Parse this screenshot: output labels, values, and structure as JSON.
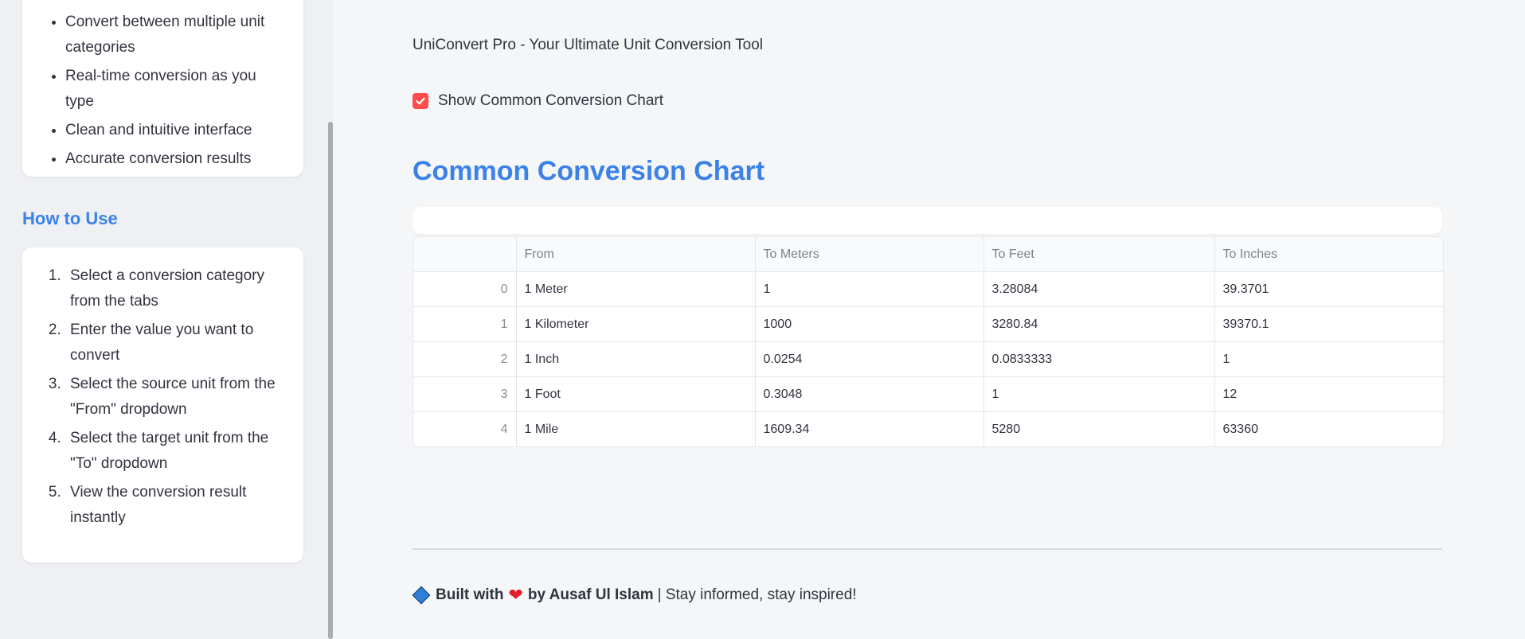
{
  "sidebar": {
    "features": [
      "Convert between multiple unit categories",
      "Real-time conversion as you type",
      "Clean and intuitive interface",
      "Accurate conversion results"
    ],
    "howto_heading": "How to Use",
    "howto_steps": [
      "Select a conversion category from the tabs",
      "Enter the value you want to convert",
      "Select the source unit from the \"From\" dropdown",
      "Select the target unit from the \"To\" dropdown",
      "View the conversion result instantly"
    ]
  },
  "main": {
    "app_title": "UniConvert Pro - Your Ultimate Unit Conversion Tool",
    "checkbox_label": "Show Common Conversion Chart",
    "checkbox_checked": true,
    "chart_heading": "Common Conversion Chart",
    "table": {
      "columns": [
        "",
        "From",
        "To Meters",
        "To Feet",
        "To Inches"
      ],
      "rows": [
        [
          "0",
          "1 Meter",
          "1",
          "3.28084",
          "39.3701"
        ],
        [
          "1",
          "1 Kilometer",
          "1000",
          "3280.84",
          "39370.1"
        ],
        [
          "2",
          "1 Inch",
          "0.0254",
          "0.0833333",
          "1"
        ],
        [
          "3",
          "1 Foot",
          "0.3048",
          "1",
          "12"
        ],
        [
          "4",
          "1 Mile",
          "1609.34",
          "5280",
          "63360"
        ]
      ]
    }
  },
  "footer": {
    "built_with": "Built with",
    "heart_icon": "heart-icon",
    "by_author": "by Ausaf Ul Islam",
    "tagline": "| Stay informed, stay inspired!"
  },
  "colors": {
    "accent": "#3b82e8",
    "checkbox": "#ff4b4b",
    "heart": "#e0202b"
  }
}
